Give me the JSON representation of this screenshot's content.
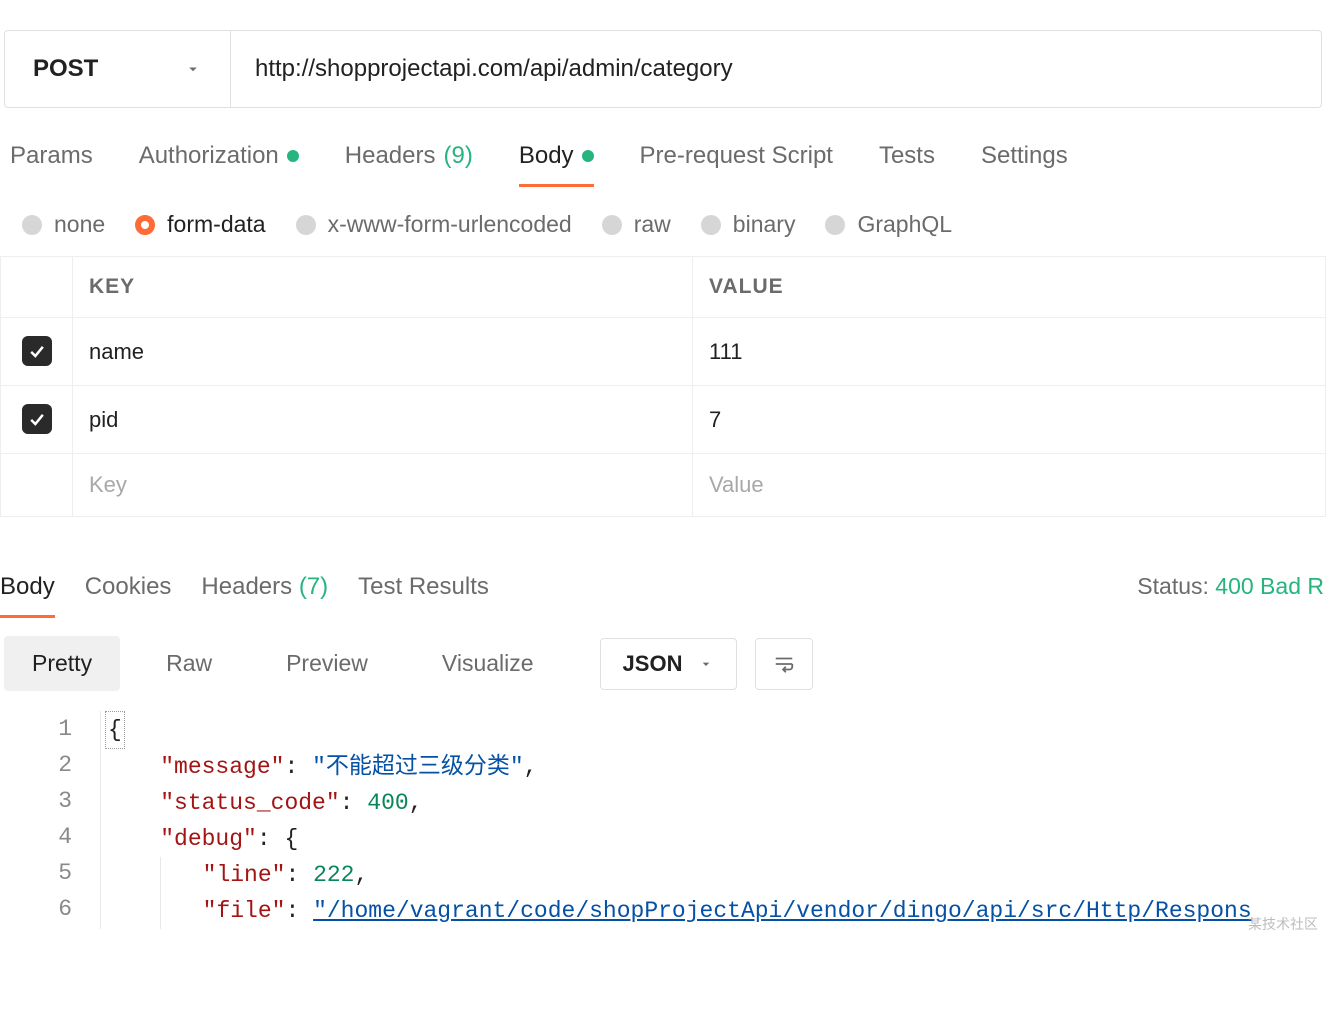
{
  "request": {
    "method": "POST",
    "url": "http://shopprojectapi.com/api/admin/category"
  },
  "tabs": {
    "params": "Params",
    "authorization": "Authorization",
    "auth_has_dot": true,
    "headers_label": "Headers",
    "headers_count": "(9)",
    "body": "Body",
    "body_has_dot": true,
    "prerequest": "Pre-request Script",
    "tests": "Tests",
    "settings": "Settings"
  },
  "body_types": {
    "none": "none",
    "formdata": "form-data",
    "urlencoded": "x-www-form-urlencoded",
    "raw": "raw",
    "binary": "binary",
    "graphql": "GraphQL",
    "selected": "form-data"
  },
  "kv": {
    "header_key": "KEY",
    "header_value": "VALUE",
    "rows": [
      {
        "enabled": true,
        "key": "name",
        "value": "111"
      },
      {
        "enabled": true,
        "key": "pid",
        "value": "7"
      }
    ],
    "placeholder_key": "Key",
    "placeholder_value": "Value"
  },
  "response": {
    "tabs": {
      "body": "Body",
      "cookies": "Cookies",
      "headers_label": "Headers",
      "headers_count": "(7)",
      "test_results": "Test Results"
    },
    "status_label": "Status:",
    "status_value": "400 Bad R",
    "views": {
      "pretty": "Pretty",
      "raw": "Raw",
      "preview": "Preview",
      "visualize": "Visualize"
    },
    "format": "JSON",
    "code": {
      "line_numbers": [
        "1",
        "2",
        "3",
        "4",
        "5",
        "6"
      ],
      "message_key": "\"message\"",
      "message_val": "\"不能超过三级分类\"",
      "status_code_key": "\"status_code\"",
      "status_code_val": "400",
      "debug_key": "\"debug\"",
      "line_key": "\"line\"",
      "line_val": "222",
      "file_key": "\"file\"",
      "file_val": "\"/home/vagrant/code/shopProjectApi/vendor/dingo/api/src/Http/Respons"
    }
  },
  "watermark": "某技术社区"
}
